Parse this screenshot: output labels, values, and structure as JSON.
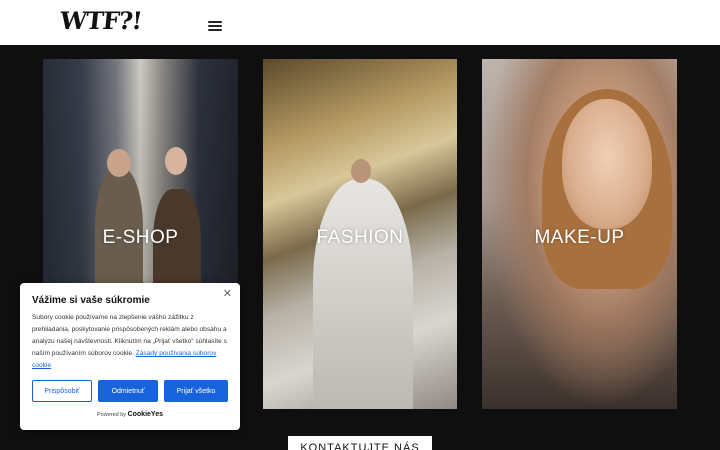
{
  "header": {
    "logo_text": "WTF?!",
    "menu_icon": "hamburger-icon"
  },
  "cards": [
    {
      "label": "E-SHOP"
    },
    {
      "label": "FASHION"
    },
    {
      "label": "MAKE-UP"
    }
  ],
  "cookie_banner": {
    "title": "Vážime si vaše súkromie",
    "close_icon": "close-icon",
    "text": "Subory cookie používame na zlepšenie vášho zážitku z prehliadania, poskytovanie prispôsobených reklám alebo obsahu a analýzu našej návštevnosti. Kliknutím na „Prijať všetko“ súhlasíte s naším používaním súborov cookie.",
    "link_text": "Zásady používania súborov cookie",
    "buttons": {
      "customize": "Prispôsobiť",
      "reject": "Odmietnuť",
      "accept": "Prijať všetko"
    },
    "powered_by": "Powered by",
    "powered_brand": "CookieYes"
  },
  "contact_button": "KONTAKTUJTE NÁS",
  "colors": {
    "accent": "#1863dc",
    "background": "#0f0f0f",
    "header": "#ffffff"
  }
}
